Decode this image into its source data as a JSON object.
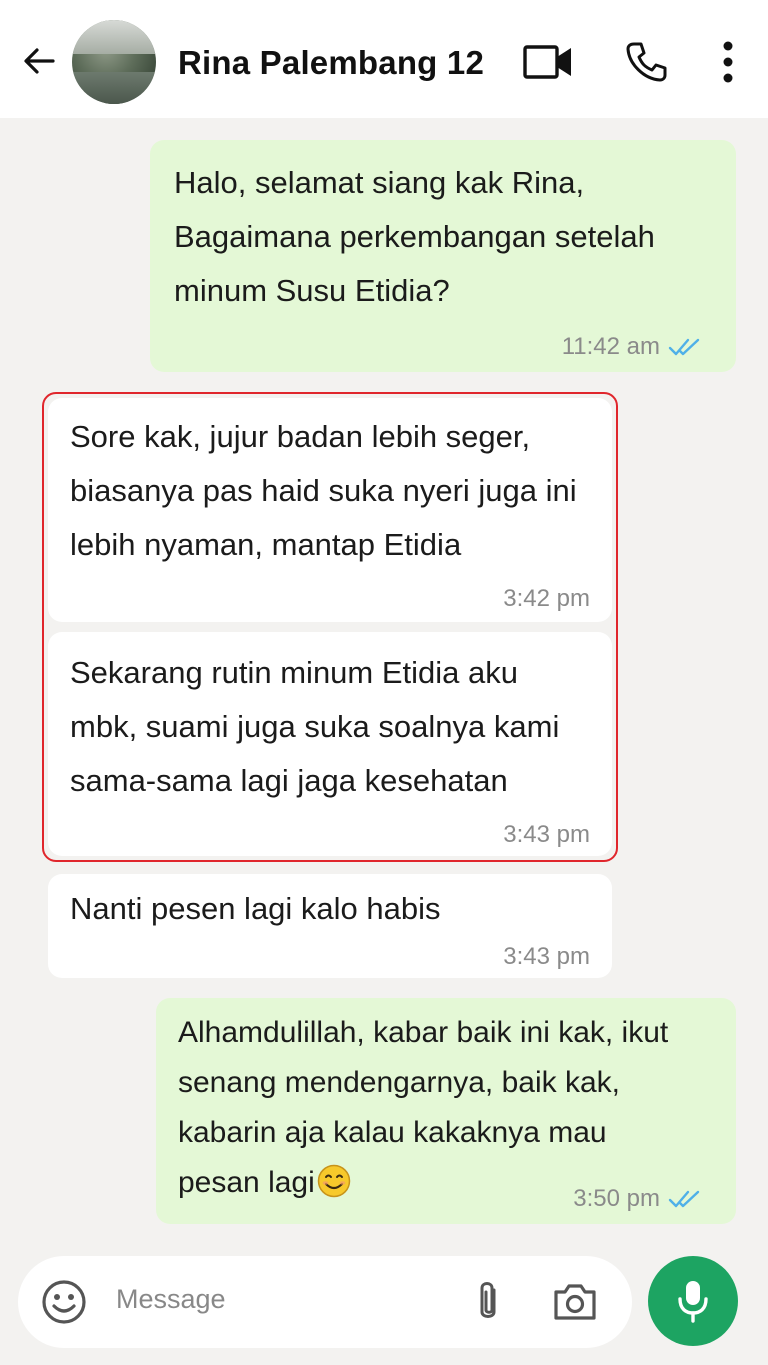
{
  "header": {
    "back_icon": "arrow-left-icon",
    "contact_name": "Rina Palembang 12",
    "video_icon": "video-camera-icon",
    "call_icon": "phone-icon",
    "menu_icon": "more-vertical-icon"
  },
  "messages": [
    {
      "direction": "out",
      "text": "Halo, selamat siang kak Rina,\nBagaimana perkembangan setelah\nminum Susu Etidia?",
      "time": "11:42 am",
      "read": true
    },
    {
      "direction": "in",
      "text": "Sore kak, jujur badan lebih seger,\nbiasanya pas haid suka nyeri juga ini\nlebih nyaman, mantap Etidia",
      "time": "3:42 pm"
    },
    {
      "direction": "in",
      "text": "Sekarang rutin minum Etidia aku\nmbk, suami juga suka soalnya kami\nsama-sama lagi jaga kesehatan",
      "time": "3:43 pm"
    },
    {
      "direction": "in",
      "text": "Nanti pesen lagi kalo habis",
      "time": "3:43 pm"
    },
    {
      "direction": "out",
      "text": "Alhamdulillah, kabar baik ini kak, ikut\nsenang mendengarnya, baik kak,\nkabarin aja kalau kakaknya mau\npesan lagi",
      "emoji": "smiling-face-icon",
      "time": "3:50 pm",
      "read": true
    }
  ],
  "input": {
    "placeholder": "Message",
    "emoji_icon": "emoji-icon",
    "attach_icon": "paperclip-icon",
    "camera_icon": "camera-icon",
    "mic_icon": "microphone-icon"
  },
  "colors": {
    "outgoing_bubble": "#e4f8d6",
    "incoming_bubble": "#ffffff",
    "read_ticks": "#4fb0e8",
    "mic_button": "#1da462",
    "highlight_border": "#e0262c"
  }
}
